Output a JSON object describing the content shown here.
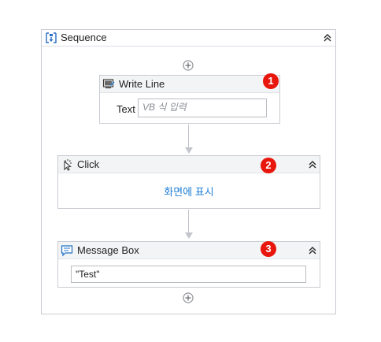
{
  "sequence": {
    "title": "Sequence",
    "icon": "sequence-icon",
    "collapse_icon": "double-chevron-up-icon"
  },
  "activities": [
    {
      "title": "Write Line",
      "icon": "write-line-icon",
      "badge": "1",
      "field_label": "Text",
      "field_placeholder": "VB 식 입력"
    },
    {
      "title": "Click",
      "icon": "click-icon",
      "badge": "2",
      "body_link": "화면에 표시",
      "collapse_icon": "double-chevron-up-icon"
    },
    {
      "title": "Message Box",
      "icon": "message-box-icon",
      "badge": "3",
      "field_value": "\"Test\"",
      "collapse_icon": "double-chevron-up-icon"
    }
  ],
  "add_icon": "plus-circle-icon",
  "colors": {
    "badge": "#e8160c",
    "link": "#1f7fd6",
    "border": "#c9ccd2",
    "header_bg": "#f3f4f6"
  }
}
